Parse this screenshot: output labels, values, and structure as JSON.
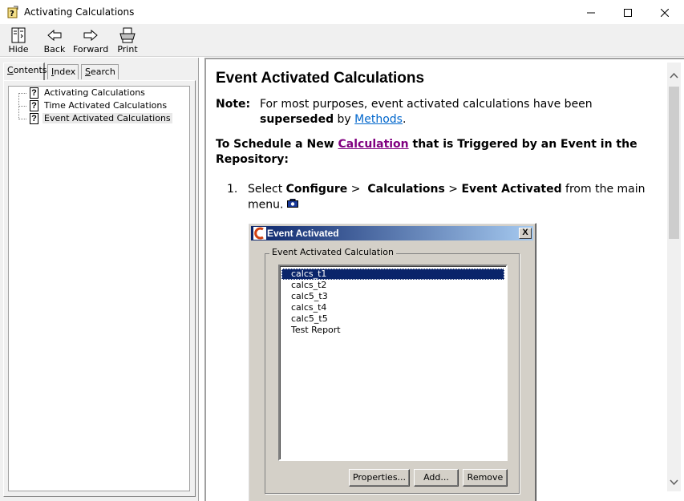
{
  "window": {
    "title": "Activating Calculations"
  },
  "toolbar": {
    "hide": "Hide",
    "back": "Back",
    "forward": "Forward",
    "print": "Print"
  },
  "nav": {
    "tabs": [
      {
        "label_pre": "",
        "label_u": "C",
        "label_post": "ontents"
      },
      {
        "label_pre": "",
        "label_u": "I",
        "label_post": "ndex"
      },
      {
        "label_pre": "",
        "label_u": "S",
        "label_post": "earch"
      }
    ],
    "tree": [
      {
        "label": "Activating Calculations"
      },
      {
        "label": "Time Activated Calculations"
      },
      {
        "label": "Event Activated Calculations"
      }
    ]
  },
  "content": {
    "heading": "Event Activated Calculations",
    "note_label": "Note:",
    "note_text_1": "For most purposes, event activated calculations have been",
    "note_bold": "superseded",
    "note_text_2": "by",
    "note_link": "Methods",
    "note_end": ".",
    "subhead_1": "To Schedule a New",
    "subhead_link": "Calculation",
    "subhead_2": "that is Triggered by an Event in the Repository:",
    "step_num": "1.",
    "step_pre": "Select",
    "step_b1": "Configure",
    "step_sep1": ">",
    "step_b2": "Calculations",
    "step_sep2": ">",
    "step_b3": "Event Activated",
    "step_post": "from the main menu."
  },
  "dialog": {
    "title": "Event Activated",
    "close": "X",
    "group_label": "Event Activated Calculation",
    "items": [
      "calcs_t1",
      "calcs_t2",
      "calc5_t3",
      "calcs_t4",
      "calc5_t5",
      "Test Report"
    ],
    "btn_properties": "Properties...",
    "btn_add": "Add...",
    "btn_remove": "Remove"
  }
}
